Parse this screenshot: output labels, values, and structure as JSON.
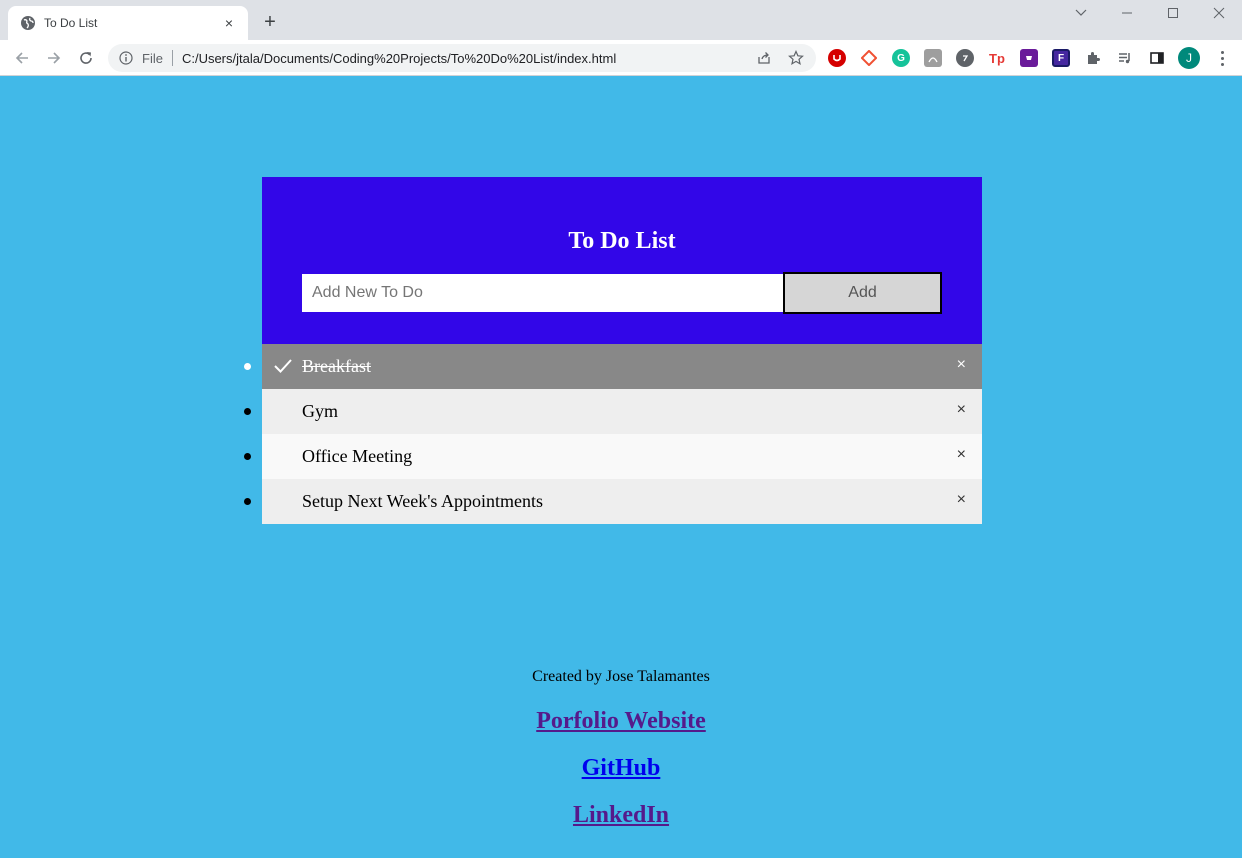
{
  "browser": {
    "tab_title": "To Do List",
    "tab_close": "×",
    "new_tab": "+",
    "omnibox_scheme": "File",
    "url": "C:/Users/jtala/Documents/Coding%20Projects/To%20Do%20List/index.html",
    "profile_initial": "J",
    "extensions": [
      "ublock-icon",
      "git-icon",
      "grammarly-icon",
      "pdf-icon",
      "ext-circle-icon",
      "tp-icon",
      "purple-ext-icon",
      "f-ext-icon",
      "puzzle-icon",
      "media-icon",
      "sidepanel-icon"
    ]
  },
  "app": {
    "title": "To Do List",
    "input_placeholder": "Add New To Do",
    "add_label": "Add",
    "items": [
      {
        "label": "Breakfast",
        "checked": true
      },
      {
        "label": "Gym",
        "checked": false
      },
      {
        "label": "Office Meeting",
        "checked": false
      },
      {
        "label": "Setup Next Week's Appointments",
        "checked": false
      }
    ],
    "close_symbol": "×"
  },
  "footer": {
    "credit": "Created by Jose Talamantes",
    "links": [
      "Porfolio Website",
      "GitHub",
      "LinkedIn"
    ]
  },
  "colors": {
    "page_bg": "#41b9e8",
    "header_bg": "#3206e8",
    "checked_bg": "#888888",
    "odd_bg": "#eeeeee",
    "even_bg": "#f9f9f9"
  }
}
